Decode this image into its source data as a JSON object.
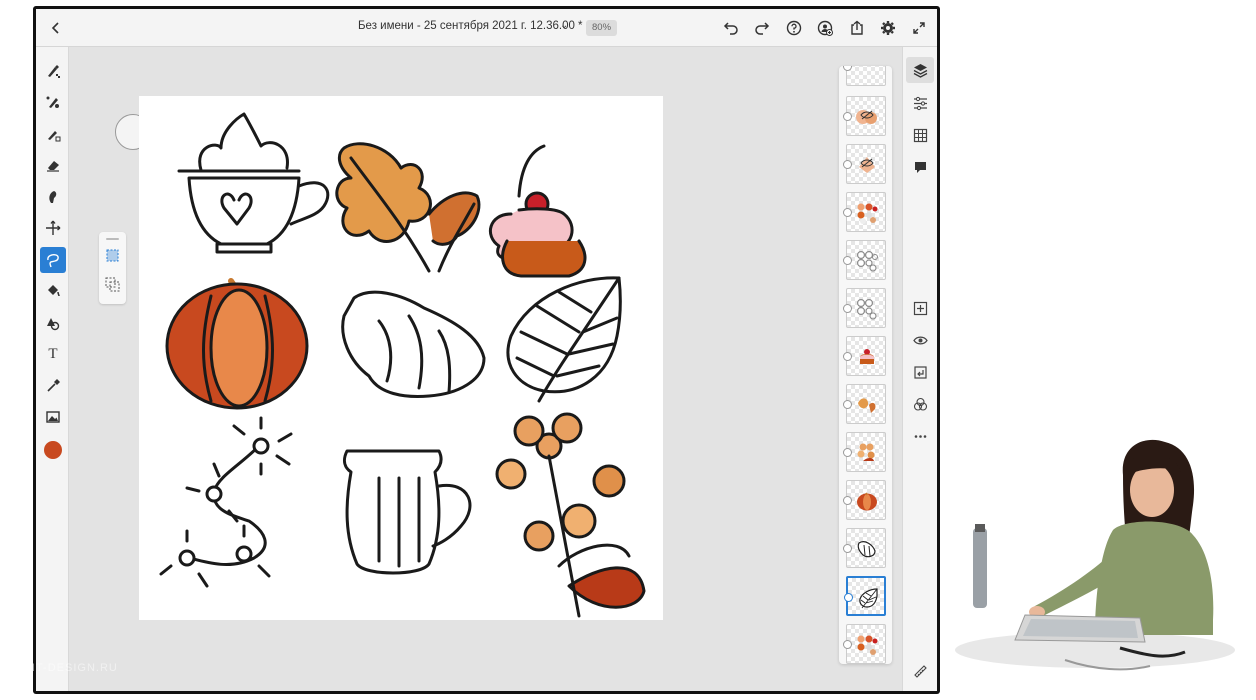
{
  "topbar": {
    "title": "Без имени - 25 сентября 2021 г. 12.36.00 *",
    "zoom": "80%"
  },
  "icons": {
    "back": "chevron-left-icon",
    "undo": "undo-icon",
    "redo": "redo-icon",
    "help": "help-icon",
    "user": "add-user-icon",
    "share": "share-icon",
    "settings": "gear-icon",
    "fullscreen": "fullscreen-icon"
  },
  "tools": [
    "pixel-brush",
    "live-brush",
    "vector-brush",
    "eraser",
    "smudge",
    "transform",
    "selection",
    "fill",
    "shapes",
    "text",
    "eyedropper",
    "image"
  ],
  "current_color": "#c8491f",
  "layers_count": 13,
  "selected_layer": "leaf-outline",
  "right_panel": [
    "layers",
    "properties",
    "grid",
    "comments",
    "add-layer",
    "visibility",
    "merge",
    "blend",
    "more"
  ],
  "watermark": "UDIT-DESIGN.RU"
}
